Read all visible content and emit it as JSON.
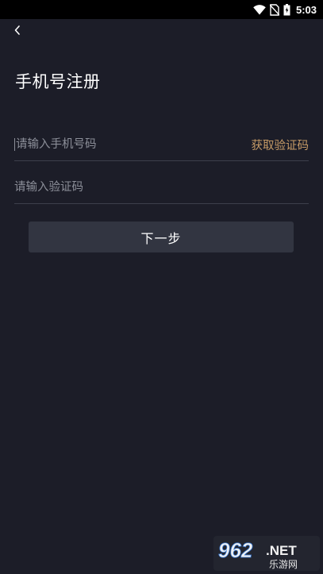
{
  "status_bar": {
    "time": "5:03",
    "icons": [
      "wifi-icon",
      "no-sim-icon",
      "battery-icon"
    ]
  },
  "header": {
    "back_icon": "chevron-left-icon",
    "title": "手机号注册"
  },
  "form": {
    "phone_placeholder": "请输入手机号码",
    "get_code_label": "获取验证码",
    "code_placeholder": "请输入验证码",
    "next_label": "下一步"
  },
  "watermark": {
    "number": "962",
    "domain": ".NET",
    "caption": "乐游网"
  },
  "colors": {
    "background": "#1c1d28",
    "accent": "#c59a66",
    "button": "#323541",
    "divider": "#3d3f4c",
    "placeholder": "#8c8f99"
  }
}
